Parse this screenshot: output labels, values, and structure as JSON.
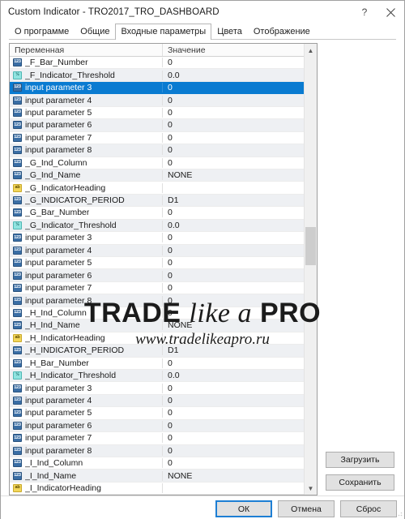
{
  "window": {
    "title": "Custom Indicator - TRO2017_TRO_DASHBOARD",
    "help_label": "?",
    "close_label": "✕"
  },
  "tabs": [
    {
      "label": "О программе",
      "active": false
    },
    {
      "label": "Общие",
      "active": false
    },
    {
      "label": "Входные параметры",
      "active": true
    },
    {
      "label": "Цвета",
      "active": false
    },
    {
      "label": "Отображение",
      "active": false
    }
  ],
  "grid": {
    "headers": {
      "name": "Переменная",
      "value": "Значение"
    },
    "rows": [
      {
        "icon": "int-icon",
        "type": "int",
        "name": "_F_Bar_Number",
        "value": "0",
        "selected": false
      },
      {
        "icon": "double-icon",
        "type": "dbl",
        "name": "_F_Indicator_Threshold",
        "value": "0.0",
        "selected": false
      },
      {
        "icon": "int-icon",
        "type": "int",
        "name": "input parameter 3",
        "value": "0",
        "selected": true
      },
      {
        "icon": "int-icon",
        "type": "int",
        "name": "input parameter 4",
        "value": "0",
        "selected": false
      },
      {
        "icon": "int-icon",
        "type": "int",
        "name": "input parameter 5",
        "value": "0",
        "selected": false
      },
      {
        "icon": "int-icon",
        "type": "int",
        "name": "input parameter 6",
        "value": "0",
        "selected": false
      },
      {
        "icon": "int-icon",
        "type": "int",
        "name": "input parameter 7",
        "value": "0",
        "selected": false
      },
      {
        "icon": "int-icon",
        "type": "int",
        "name": "input parameter 8",
        "value": "0",
        "selected": false
      },
      {
        "icon": "int-icon",
        "type": "int",
        "name": "_G_Ind_Column",
        "value": "0",
        "selected": false
      },
      {
        "icon": "int-icon",
        "type": "int",
        "name": "_G_Ind_Name",
        "value": "NONE",
        "selected": false
      },
      {
        "icon": "string-icon",
        "type": "str",
        "name": "_G_IndicatorHeading",
        "value": "",
        "selected": false
      },
      {
        "icon": "int-icon",
        "type": "int",
        "name": "_G_INDICATOR_PERIOD",
        "value": "D1",
        "selected": false
      },
      {
        "icon": "int-icon",
        "type": "int",
        "name": "_G_Bar_Number",
        "value": "0",
        "selected": false
      },
      {
        "icon": "double-icon",
        "type": "dbl",
        "name": "_G_Indicator_Threshold",
        "value": "0.0",
        "selected": false
      },
      {
        "icon": "int-icon",
        "type": "int",
        "name": "input parameter 3",
        "value": "0",
        "selected": false
      },
      {
        "icon": "int-icon",
        "type": "int",
        "name": "input parameter 4",
        "value": "0",
        "selected": false
      },
      {
        "icon": "int-icon",
        "type": "int",
        "name": "input parameter 5",
        "value": "0",
        "selected": false
      },
      {
        "icon": "int-icon",
        "type": "int",
        "name": "input parameter 6",
        "value": "0",
        "selected": false
      },
      {
        "icon": "int-icon",
        "type": "int",
        "name": "input parameter 7",
        "value": "0",
        "selected": false
      },
      {
        "icon": "int-icon",
        "type": "int",
        "name": "input parameter 8",
        "value": "0",
        "selected": false
      },
      {
        "icon": "int-icon",
        "type": "int",
        "name": "_H_Ind_Column",
        "value": "0",
        "selected": false
      },
      {
        "icon": "int-icon",
        "type": "int",
        "name": "_H_Ind_Name",
        "value": "NONE",
        "selected": false
      },
      {
        "icon": "string-icon",
        "type": "str",
        "name": "_H_IndicatorHeading",
        "value": "",
        "selected": false
      },
      {
        "icon": "int-icon",
        "type": "int",
        "name": "_H_INDICATOR_PERIOD",
        "value": "D1",
        "selected": false
      },
      {
        "icon": "int-icon",
        "type": "int",
        "name": "_H_Bar_Number",
        "value": "0",
        "selected": false
      },
      {
        "icon": "double-icon",
        "type": "dbl",
        "name": "_H_Indicator_Threshold",
        "value": "0.0",
        "selected": false
      },
      {
        "icon": "int-icon",
        "type": "int",
        "name": "input parameter 3",
        "value": "0",
        "selected": false
      },
      {
        "icon": "int-icon",
        "type": "int",
        "name": "input parameter 4",
        "value": "0",
        "selected": false
      },
      {
        "icon": "int-icon",
        "type": "int",
        "name": "input parameter 5",
        "value": "0",
        "selected": false
      },
      {
        "icon": "int-icon",
        "type": "int",
        "name": "input parameter 6",
        "value": "0",
        "selected": false
      },
      {
        "icon": "int-icon",
        "type": "int",
        "name": "input parameter 7",
        "value": "0",
        "selected": false
      },
      {
        "icon": "int-icon",
        "type": "int",
        "name": "input parameter 8",
        "value": "0",
        "selected": false
      },
      {
        "icon": "int-icon",
        "type": "int",
        "name": "_I_Ind_Column",
        "value": "0",
        "selected": false
      },
      {
        "icon": "int-icon",
        "type": "int",
        "name": "_I_Ind_Name",
        "value": "NONE",
        "selected": false
      },
      {
        "icon": "string-icon",
        "type": "str",
        "name": "_I_IndicatorHeading",
        "value": "",
        "selected": false
      }
    ]
  },
  "side_buttons": {
    "load": "Загрузить",
    "save": "Сохранить"
  },
  "footer_buttons": {
    "ok": "ОК",
    "cancel": "Отмена",
    "reset": "Сброс"
  },
  "watermark": {
    "word1": "TRADE",
    "word2": "like a",
    "word3": "PRO",
    "url": "www.tradelikeapro.ru"
  },
  "colors": {
    "selection": "#0a7bd1",
    "focus_border": "#1e7fd4",
    "int_icon": "#3a6ea5",
    "double_icon": "#8fe3e0",
    "string_icon": "#f2d65a"
  }
}
